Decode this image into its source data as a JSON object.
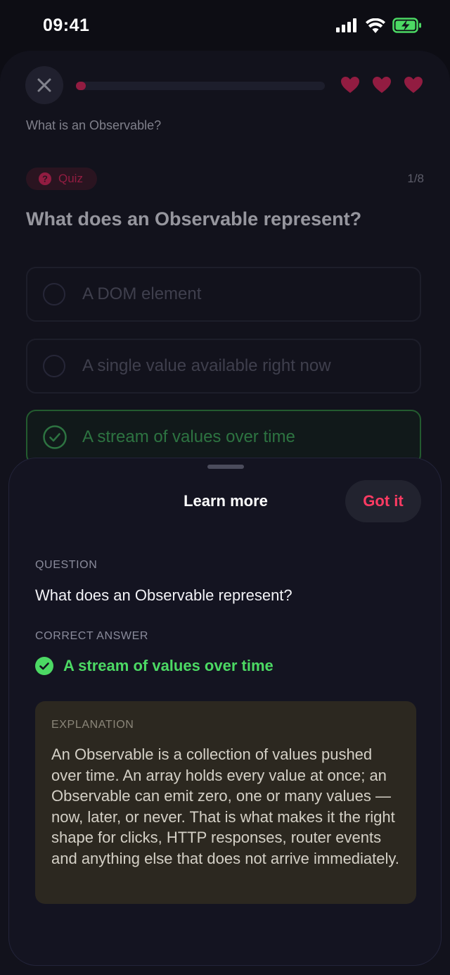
{
  "status_bar": {
    "time": "09:41"
  },
  "quiz": {
    "lesson_title": "What is an Observable?",
    "progress": 0.04,
    "hearts": 3,
    "badge_label": "Quiz",
    "counter": "1/8",
    "question": "What does an Observable represent?",
    "options": [
      {
        "label": "A DOM element",
        "state": "default"
      },
      {
        "label": "A single value available right now",
        "state": "default"
      },
      {
        "label": "A stream of values over time",
        "state": "correct"
      }
    ]
  },
  "sheet": {
    "title": "Learn more",
    "got_it_label": "Got it",
    "question_label": "QUESTION",
    "question": "What does an Observable represent?",
    "correct_answer_label": "CORRECT ANSWER",
    "correct_answer": "A stream of values over time",
    "explanation_label": "EXPLANATION",
    "explanation": "An Observable is a collection of values pushed over time. An array holds every value at once; an Observable can emit zero, one or many values — now, later, or never. That is what makes it the right shape for clicks, HTTP responses, router events and anything else that does not arrive immediately."
  },
  "colors": {
    "accent": "#e2245a",
    "got_it": "#ff3b63",
    "success": "#4cd964",
    "explanation_bg": "#2c2820"
  },
  "icons": {
    "close": "close-icon",
    "heart": "heart-icon",
    "quiz_badge": "question-circle-icon",
    "check": "check-circle-icon",
    "signal": "signal-icon",
    "wifi": "wifi-icon",
    "battery": "battery-charging-icon"
  }
}
